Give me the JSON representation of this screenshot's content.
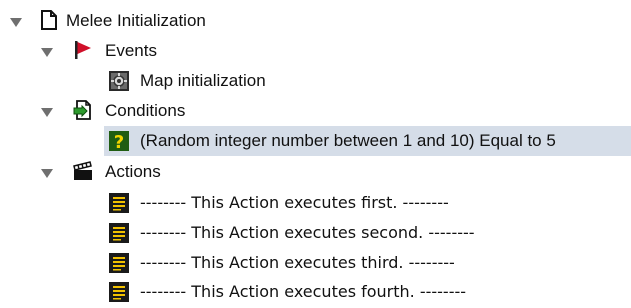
{
  "tree": {
    "root": {
      "label": "Melee Initialization",
      "icon": "trigger-document-icon"
    },
    "events": {
      "label": "Events",
      "icon": "red-flag-icon",
      "items": [
        {
          "label": "Map initialization",
          "icon": "gear-map-icon"
        }
      ]
    },
    "conditions": {
      "label": "Conditions",
      "icon": "conditions-doc-icon",
      "items": [
        {
          "label": "(Random integer number between 1 and 10) Equal to 5",
          "icon": "question-mark-icon",
          "selected": true
        }
      ]
    },
    "actions": {
      "label": "Actions",
      "icon": "clapperboard-icon",
      "items": [
        {
          "label": "-------- This Action executes first. --------",
          "icon": "comment-icon"
        },
        {
          "label": "-------- This Action executes second. --------",
          "icon": "comment-icon"
        },
        {
          "label": "-------- This Action executes third. --------",
          "icon": "comment-icon"
        },
        {
          "label": "-------- This Action executes fourth. --------",
          "icon": "comment-icon"
        }
      ]
    }
  },
  "colors": {
    "selection": "#d5dde8",
    "flag": "#d0102a",
    "comment_bg": "#1a1a1a",
    "comment_lines": "#f2c200",
    "question_bg": "#1f5d12",
    "question_fg": "#f0d400"
  }
}
